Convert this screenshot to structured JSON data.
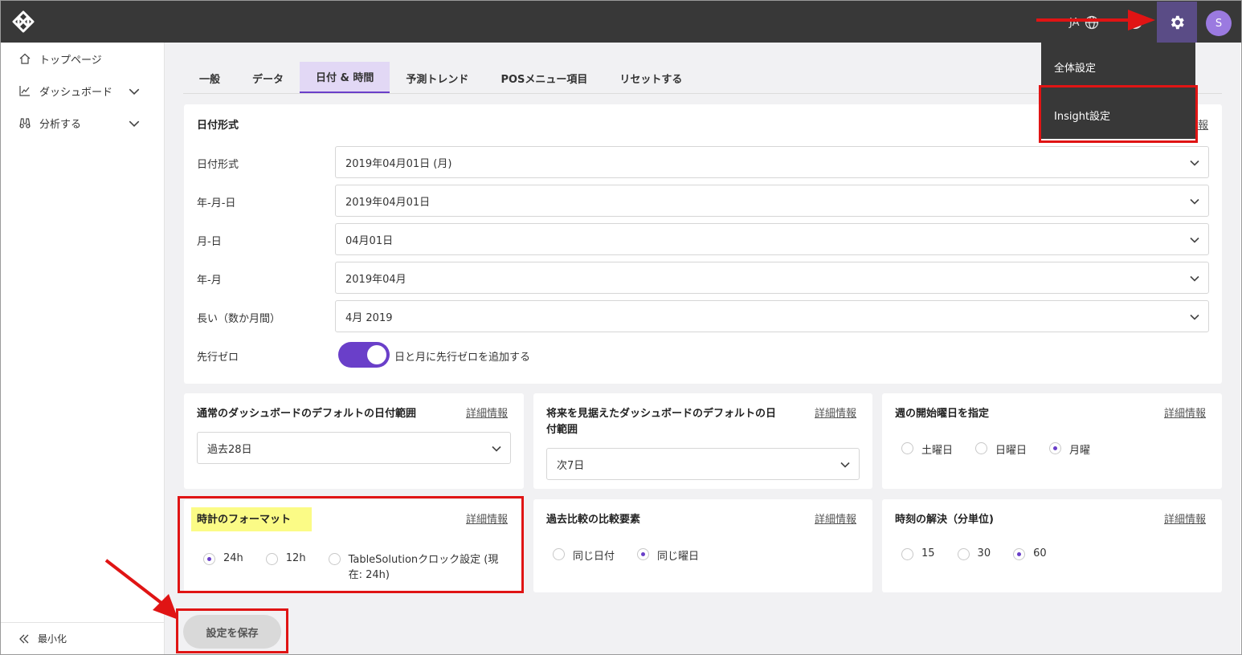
{
  "topbar": {
    "lang": "JA",
    "avatar_initial": "S"
  },
  "settings_menu": {
    "items": [
      "全体設定",
      "Insight設定"
    ]
  },
  "sidebar": {
    "items": [
      {
        "label": "トップページ"
      },
      {
        "label": "ダッシュボード"
      },
      {
        "label": "分析する"
      }
    ],
    "minimize_label": "最小化"
  },
  "tabs": [
    "一般",
    "データ",
    "日付 & 時間",
    "予測トレンド",
    "POSメニュー項目",
    "リセットする"
  ],
  "active_tab": "日付 & 時間",
  "date_format": {
    "title": "日付形式",
    "more_partial": "報",
    "rows": [
      {
        "label": "日付形式",
        "value": "2019年04月01日 (月)"
      },
      {
        "label": "年-月-日",
        "value": "2019年04月01日"
      },
      {
        "label": "月-日",
        "value": "04月01日"
      },
      {
        "label": "年-月",
        "value": "2019年04月"
      },
      {
        "label": "長い（数か月間）",
        "value": "4月 2019"
      }
    ],
    "leading_zero_label": "先行ゼロ",
    "leading_zero_text": "日と月に先行ゼロを追加する",
    "leading_zero_on": true
  },
  "more_info": "詳細情報",
  "default_range": {
    "title": "通常のダッシュボードのデフォルトの日付範囲",
    "value": "過去28日"
  },
  "future_range": {
    "title_line1": "将来を見据えたダッシュボードのデフォルトの日",
    "title_line2": "付範囲",
    "value": "次7日"
  },
  "week_start": {
    "title": "週の開始曜日を指定",
    "options": [
      "土曜日",
      "日曜日",
      "月曜"
    ],
    "selected": 2
  },
  "clock_format": {
    "title": "時計のフォーマット",
    "options": [
      "24h",
      "12h"
    ],
    "option3_line1": "TableSolutionクロック設定 (現",
    "option3_line2": "在: 24h)",
    "selected": 0
  },
  "compare": {
    "title": "過去比較の比較要素",
    "options": [
      "同じ日付",
      "同じ曜日"
    ],
    "selected": 1
  },
  "time_resolution": {
    "title": "時刻の解決（分単位)",
    "options": [
      "15",
      "30",
      "60"
    ],
    "selected": 2
  },
  "save_label": "設定を保存",
  "colors": {
    "accent": "#6a3fc9",
    "topbar": "#383838",
    "highlight_red": "#e01414",
    "marker_yellow": "#fbfb86"
  }
}
